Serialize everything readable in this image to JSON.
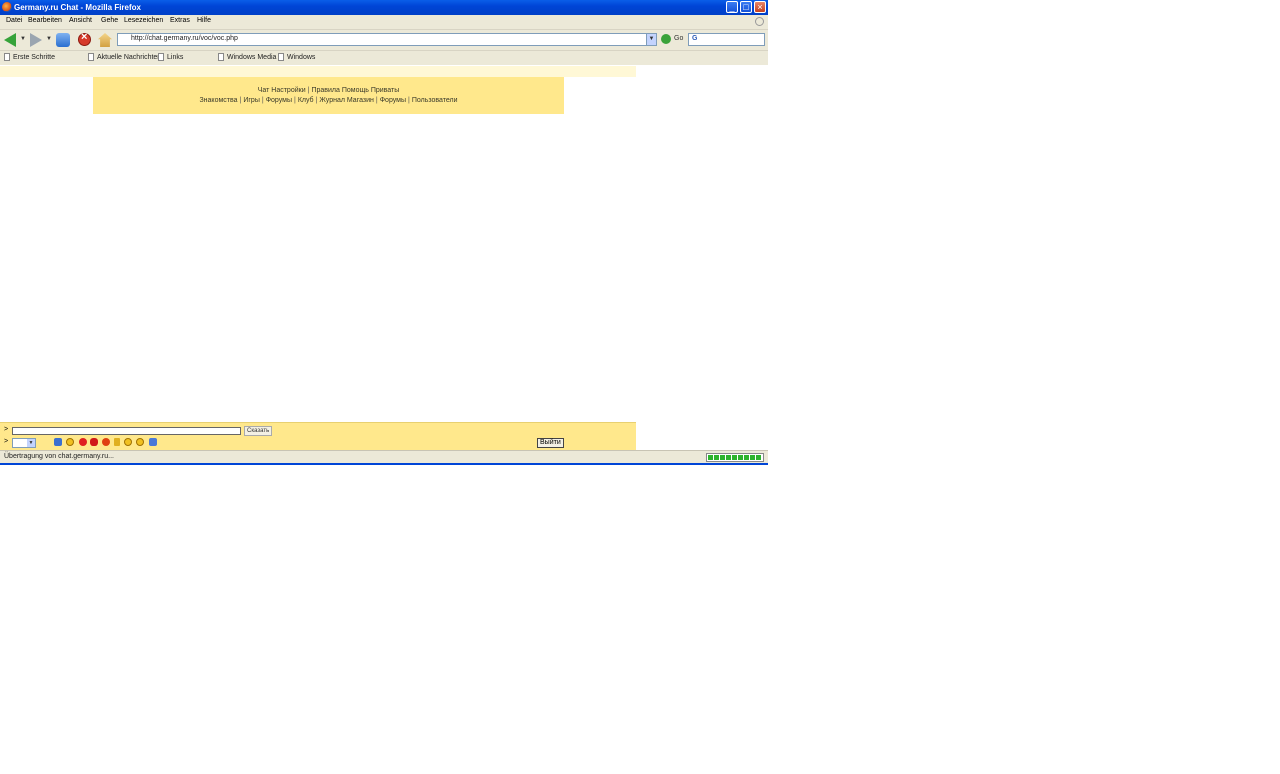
{
  "window": {
    "title": "Germany.ru Chat - Mozilla Firefox",
    "minimize_label": "_",
    "maximize_label": "□",
    "close_label": "×"
  },
  "menubar": [
    "Datei",
    "Bearbeiten",
    "Ansicht",
    "Gehe",
    "Lesezeichen",
    "Extras",
    "Hilfe"
  ],
  "toolbar": {
    "url": "http://chat.germany.ru/voc/voc.php",
    "go_label": "Go",
    "search_engine": "G"
  },
  "bookmarks": [
    "Erste Schritte",
    "Aktuelle Nachrichten",
    "Links",
    "Windows Media",
    "Windows"
  ],
  "chat_menu": {
    "row1": [
      "Чат",
      "Настройки",
      "Правила",
      "Помощь",
      "Приваты"
    ],
    "row2": [
      "Знакомства",
      "Игры",
      "Форумы",
      "Клуб",
      "Журнал",
      "Магазин",
      "Форумы",
      "Пользователи"
    ]
  },
  "input_area": {
    "prompt": ">",
    "send_label": "Сказать",
    "exit_label": "Выйти",
    "smileys": [
      "thumbs-up-icon",
      "smile-icon",
      "heart-icon",
      "lips-icon",
      "flower-icon",
      "trophy-icon",
      "grin-icon",
      "sad-icon",
      "wave-icon"
    ]
  },
  "status": {
    "text": "Übertragung von chat.germany.ru...",
    "progress": 1.0
  },
  "colors": {
    "chat_panel": "#ffe88c",
    "title_bar": "#0a5ee8"
  }
}
